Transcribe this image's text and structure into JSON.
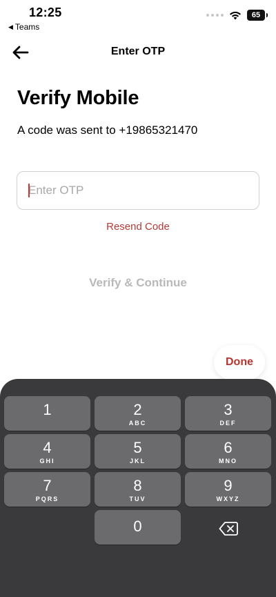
{
  "status_bar": {
    "time": "12:25",
    "back_app": "Teams",
    "back_icon": "triangle-left-icon",
    "battery": "65"
  },
  "nav": {
    "title": "Enter OTP",
    "back_icon": "arrow-left-icon"
  },
  "content": {
    "heading": "Verify Mobile",
    "subtext": "A code was sent to +19865321470",
    "otp_placeholder": "Enter OTP",
    "otp_value": "",
    "resend_label": "Resend Code",
    "verify_label": "Verify & Continue"
  },
  "keyboard": {
    "done_label": "Done",
    "keys": [
      {
        "num": "1",
        "letters": ""
      },
      {
        "num": "2",
        "letters": "ABC"
      },
      {
        "num": "3",
        "letters": "DEF"
      },
      {
        "num": "4",
        "letters": "GHI"
      },
      {
        "num": "5",
        "letters": "JKL"
      },
      {
        "num": "6",
        "letters": "MNO"
      },
      {
        "num": "7",
        "letters": "PQRS"
      },
      {
        "num": "8",
        "letters": "TUV"
      },
      {
        "num": "9",
        "letters": "WXYZ"
      },
      {
        "num": "0",
        "letters": ""
      }
    ],
    "delete_icon": "backspace-icon"
  },
  "colors": {
    "accent": "#b33a36",
    "disabled_text": "#b9b9b9",
    "keyboard_bg": "#3a3a3c",
    "key_bg": "#6b6b6d"
  }
}
